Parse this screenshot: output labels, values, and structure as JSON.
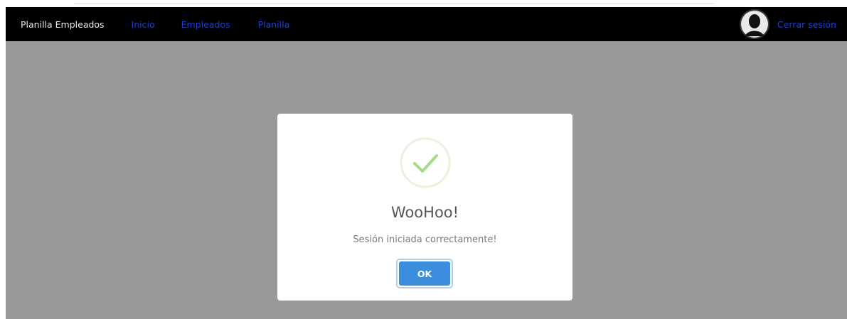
{
  "navbar": {
    "brand": "Planilla Empleados",
    "links": [
      {
        "label": "Inicio"
      },
      {
        "label": "Empleados"
      },
      {
        "label": "Planilla"
      }
    ],
    "logout_label": "Cerrar sesión",
    "avatar_icon": "user-silhouette-icon"
  },
  "modal": {
    "icon": "success-check-icon",
    "title": "WooHoo!",
    "message": "Sesión iniciada correctamente!",
    "ok_label": "OK"
  },
  "colors": {
    "navbar_bg": "#000000",
    "nav_link": "#1d3fcf",
    "overlay": "#999999",
    "ok_button": "#3b8ddd",
    "success_check": "#a5dc86"
  }
}
